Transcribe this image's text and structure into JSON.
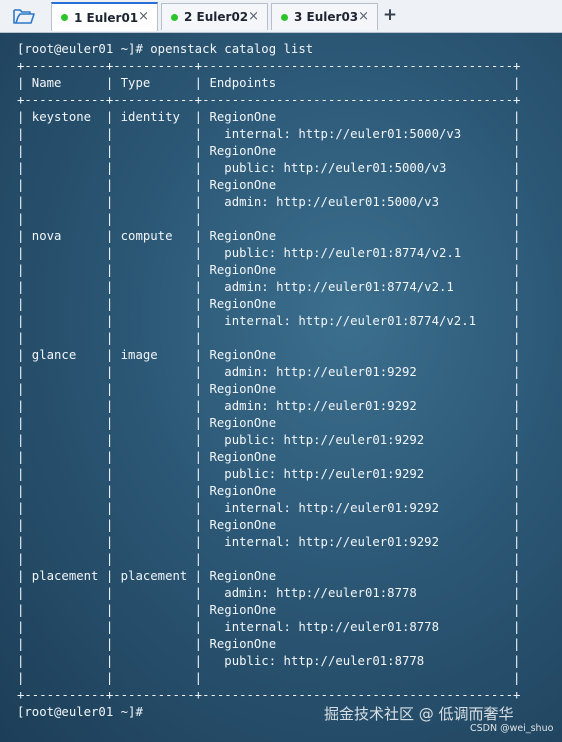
{
  "toolbar": {
    "folder_icon": "folder-open-icon"
  },
  "tabs": [
    {
      "label": "1 Euler01",
      "status_color": "#2bc42b",
      "close_glyph": "×",
      "active": true
    },
    {
      "label": "2 Euler02",
      "status_color": "#2bc42b",
      "close_glyph": "×",
      "active": false
    },
    {
      "label": "3 Euler03",
      "status_color": "#2bc42b",
      "close_glyph": "×",
      "active": false
    }
  ],
  "add_tab_glyph": "+",
  "terminal": {
    "lines": [
      "[root@euler01 ~]# openstack catalog list",
      "+-----------+-----------+------------------------------------------+",
      "| Name      | Type      | Endpoints                                |",
      "+-----------+-----------+------------------------------------------+",
      "| keystone  | identity  | RegionOne                                |",
      "|           |           |   internal: http://euler01:5000/v3       |",
      "|           |           | RegionOne                                |",
      "|           |           |   public: http://euler01:5000/v3         |",
      "|           |           | RegionOne                                |",
      "|           |           |   admin: http://euler01:5000/v3          |",
      "|           |           |                                          |",
      "| nova      | compute   | RegionOne                                |",
      "|           |           |   public: http://euler01:8774/v2.1       |",
      "|           |           | RegionOne                                |",
      "|           |           |   admin: http://euler01:8774/v2.1        |",
      "|           |           | RegionOne                                |",
      "|           |           |   internal: http://euler01:8774/v2.1     |",
      "|           |           |                                          |",
      "| glance    | image     | RegionOne                                |",
      "|           |           |   admin: http://euler01:9292             |",
      "|           |           | RegionOne                                |",
      "|           |           |   admin: http://euler01:9292             |",
      "|           |           | RegionOne                                |",
      "|           |           |   public: http://euler01:9292            |",
      "|           |           | RegionOne                                |",
      "|           |           |   public: http://euler01:9292            |",
      "|           |           | RegionOne                                |",
      "|           |           |   internal: http://euler01:9292          |",
      "|           |           | RegionOne                                |",
      "|           |           |   internal: http://euler01:9292          |",
      "|           |           |                                          |",
      "| placement | placement | RegionOne                                |",
      "|           |           |   admin: http://euler01:8778             |",
      "|           |           | RegionOne                                |",
      "|           |           |   internal: http://euler01:8778          |",
      "|           |           | RegionOne                                |",
      "|           |           |   public: http://euler01:8778            |",
      "|           |           |                                          |",
      "+-----------+-----------+------------------------------------------+",
      "[root@euler01 ~]#"
    ]
  },
  "watermark": "掘金技术社区 @ 低调而奢华",
  "credit": "CSDN @wei_shuo",
  "colors": {
    "terminal_bg": "#2b5775",
    "terminal_text": "#f2f6fa",
    "tab_accent": "#2a6fd6"
  }
}
